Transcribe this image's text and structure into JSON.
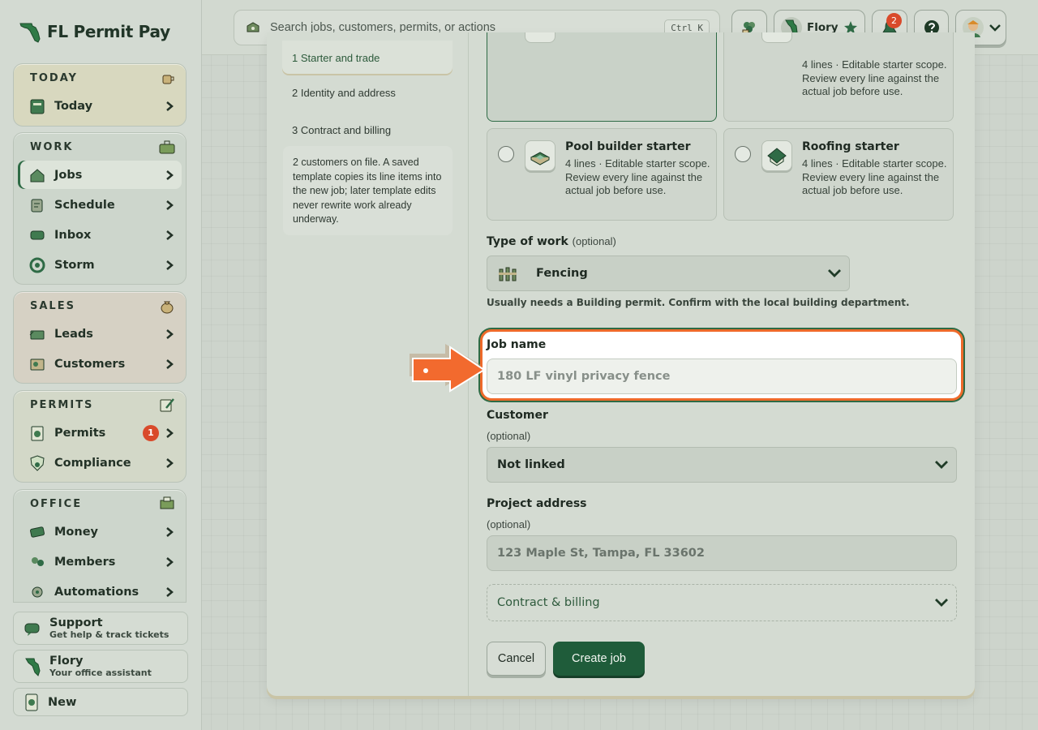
{
  "app": {
    "title": "FL Permit Pay"
  },
  "search": {
    "placeholder": "Search jobs, customers, permits, or actions",
    "shortcut": "Ctrl K"
  },
  "topbar": {
    "assistant_name": "Flory",
    "notification_count": "2"
  },
  "sidebar": {
    "groups": [
      {
        "title": "TODAY",
        "items": [
          {
            "label": "Today",
            "icon": "today-icon"
          }
        ]
      },
      {
        "title": "WORK",
        "items": [
          {
            "label": "Jobs",
            "icon": "jobs-icon",
            "active": true
          },
          {
            "label": "Schedule",
            "icon": "schedule-icon"
          },
          {
            "label": "Inbox",
            "icon": "inbox-icon"
          },
          {
            "label": "Storm",
            "icon": "storm-icon"
          }
        ]
      },
      {
        "title": "SALES",
        "items": [
          {
            "label": "Leads",
            "icon": "leads-icon"
          },
          {
            "label": "Customers",
            "icon": "customers-icon"
          }
        ]
      },
      {
        "title": "PERMITS",
        "items": [
          {
            "label": "Permits",
            "icon": "permits-icon",
            "badge": "1"
          },
          {
            "label": "Compliance",
            "icon": "compliance-icon"
          }
        ]
      },
      {
        "title": "OFFICE",
        "items": [
          {
            "label": "Money",
            "icon": "money-icon"
          },
          {
            "label": "Members",
            "icon": "members-icon"
          },
          {
            "label": "Automations",
            "icon": "automations-icon"
          }
        ]
      }
    ],
    "support": {
      "title": "Support",
      "subtitle": "Get help & track tickets"
    },
    "assistant": {
      "title": "Flory",
      "subtitle": "Your office assistant"
    },
    "new_label": "New"
  },
  "steps": {
    "current": "1 Starter and trade",
    "step2": "2 Identity and address",
    "step3": "3 Contract and billing",
    "note": "2 customers on file. A saved template copies its line items into the new job; later template edits never rewrite work already underway."
  },
  "starters": {
    "top_right_desc": "4 lines · Editable starter scope. Review every line against the actual job before use.",
    "pool": {
      "title": "Pool builder starter",
      "desc": "4 lines · Editable starter scope. Review every line against the actual job before use."
    },
    "roofing": {
      "title": "Roofing starter",
      "desc": "4 lines · Editable starter scope. Review every line against the actual job before use."
    }
  },
  "form": {
    "type_of_work_label": "Type of work",
    "optional_text": "(optional)",
    "type_of_work_value": "Fencing",
    "type_of_work_hint": "Usually needs a Building permit. Confirm with the local building department.",
    "job_name_label": "Job name",
    "job_name_placeholder": "180 LF vinyl privacy fence",
    "customer_label": "Customer",
    "customer_optional": "(optional)",
    "customer_value": "Not linked",
    "address_label": "Project address",
    "address_optional": "(optional)",
    "address_placeholder": "123 Maple St, Tampa, FL 33602",
    "contract_label": "Contract & billing",
    "cancel_label": "Cancel",
    "create_label": "Create job"
  },
  "colors": {
    "accent_green": "#1f5c3a",
    "highlight_orange": "#ee6a2a",
    "badge_red": "#d94a2b"
  }
}
